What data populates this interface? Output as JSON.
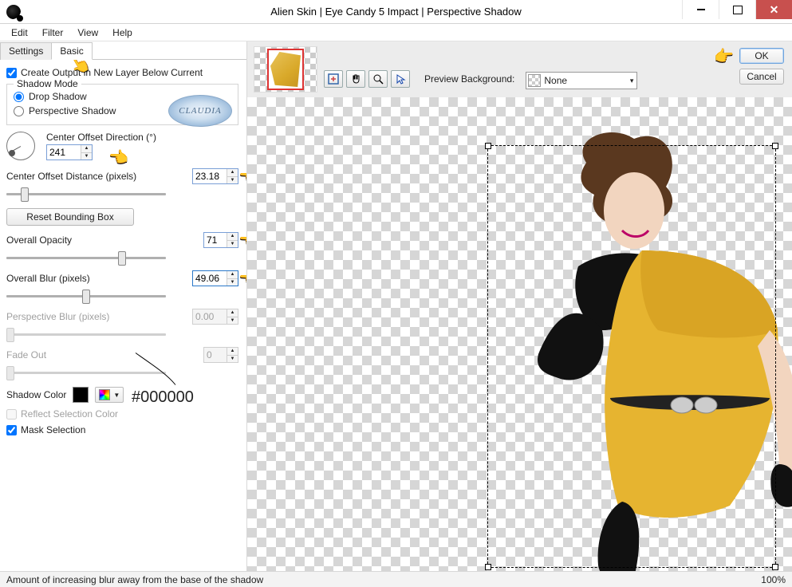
{
  "window": {
    "title": "Alien Skin | Eye Candy 5 Impact | Perspective Shadow"
  },
  "menu": {
    "items": [
      "Edit",
      "Filter",
      "View",
      "Help"
    ]
  },
  "tabs": {
    "settings": "Settings",
    "basic": "Basic",
    "active": "basic"
  },
  "controls": {
    "create_output_label": "Create Output in New Layer Below Current",
    "create_output_checked": true,
    "shadow_mode_label": "Shadow Mode",
    "shadow_mode_options": {
      "drop": "Drop Shadow",
      "perspective": "Perspective Shadow"
    },
    "shadow_mode_selected": "drop",
    "center_offset_dir_label": "Center Offset Direction (°)",
    "center_offset_dir_value": "241",
    "center_offset_dist_label": "Center Offset Distance (pixels)",
    "center_offset_dist_value": "23.18",
    "reset_bb_label": "Reset Bounding Box",
    "overall_opacity_label": "Overall Opacity",
    "overall_opacity_value": "71",
    "overall_blur_label": "Overall Blur (pixels)",
    "overall_blur_value": "49.06",
    "perspective_blur_label": "Perspective Blur (pixels)",
    "perspective_blur_value": "0.00",
    "fade_out_label": "Fade Out",
    "fade_out_value": "0",
    "shadow_color_label": "Shadow Color",
    "shadow_color_hex": "#000000",
    "reflect_sel_label": "Reflect Selection Color",
    "reflect_sel_checked": false,
    "mask_sel_label": "Mask Selection",
    "mask_sel_checked": true,
    "claudia_badge": "CLAUDIA"
  },
  "annotation": {
    "color_hex_note": "#000000"
  },
  "right_toolbar": {
    "preview_bg_label": "Preview Background:",
    "preview_bg_value": "None",
    "ok_label": "OK",
    "cancel_label": "Cancel"
  },
  "statusbar": {
    "help_text": "Amount of increasing blur away from the base of the shadow",
    "zoom": "100%"
  }
}
